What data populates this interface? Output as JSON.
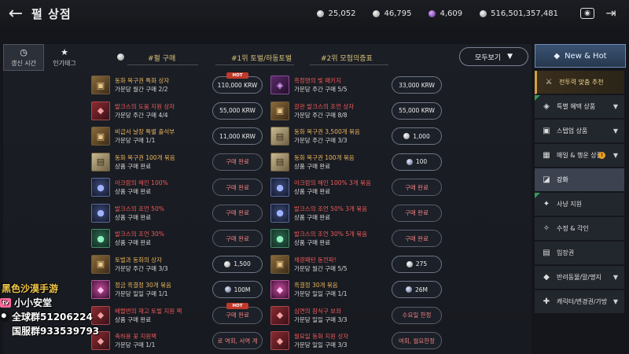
{
  "header": {
    "title": "펄 상점",
    "currencies": [
      {
        "icon": "silver-coin-icon",
        "value": "25,052"
      },
      {
        "icon": "silver-coin-icon",
        "value": "46,795"
      },
      {
        "icon": "purple-gem-icon",
        "value": "4,609"
      },
      {
        "icon": "silver-coin-icon",
        "value": "516,501,357,481"
      }
    ]
  },
  "tabs": {
    "refresh_time": "갱신 시간",
    "popular": "인기태그"
  },
  "sort_headers": [
    "#펄 구매",
    "#1위 토벌/하동토벌",
    "#2위 모험의증표"
  ],
  "filter_dropdown": "모두보기",
  "hot_label": "HOT",
  "rows": [
    [
      {
        "thumb": "chest",
        "name": "동화 복구권 특화 상자",
        "name_color": "orange",
        "limit": "가문당 월간 구매 2/2",
        "price": "110,000 KRW",
        "coin": "",
        "hot": true,
        "done": false
      },
      {
        "thumb": "purple",
        "name": "흑정령의 빛 패키지",
        "name_color": "red",
        "limit": "가문당 주간 구매 5/5",
        "price": "33,000 KRW",
        "coin": "",
        "hot": false,
        "done": false
      }
    ],
    [
      {
        "thumb": "red",
        "name": "발크스의 도움 지원 상자",
        "name_color": "red",
        "limit": "가문당 주간 구매 4/4",
        "price": "55,000 KRW",
        "coin": "",
        "hot": false,
        "done": false
      },
      {
        "thumb": "chest",
        "name": "갈관 발크스의 조언 상자",
        "name_color": "red",
        "limit": "가문당 주간 구매 8/8",
        "price": "55,000 KRW",
        "coin": "",
        "hot": false,
        "done": false
      }
    ],
    [
      {
        "thumb": "chest",
        "name": "비급서 날장 특별 출석부",
        "name_color": "orange",
        "limit": "가문당 구매 1/1",
        "price": "11,000 KRW",
        "coin": "",
        "hot": false,
        "done": false
      },
      {
        "thumb": "scroll",
        "name": "동화 복구권 3,500개 묶음",
        "name_color": "orange",
        "limit": "가문당 주간 구매 3/3",
        "price": "1,000",
        "coin": "white",
        "hot": false,
        "done": false
      }
    ],
    [
      {
        "thumb": "scroll",
        "name": "동화 복구권 100개 묶음",
        "name_color": "orange",
        "limit": "상품 구매 완료",
        "price": "구매 완료",
        "coin": "",
        "hot": false,
        "done": true
      },
      {
        "thumb": "scroll",
        "name": "동화 복구권 100개 묶음",
        "name_color": "orange",
        "limit": "상품 구매 완료",
        "price": "100",
        "coin": "blue",
        "hot": false,
        "done": false
      }
    ],
    [
      {
        "thumb": "gem",
        "name": "아크람의 해인 100%",
        "name_color": "red",
        "limit": "상품 구매 완료",
        "price": "구매 완료",
        "coin": "",
        "hot": false,
        "done": true
      },
      {
        "thumb": "gem",
        "name": "아크람의 해인 100% 3개 묶음",
        "name_color": "red",
        "limit": "상품 구매 완료",
        "price": "구매 완료",
        "coin": "",
        "hot": false,
        "done": true
      }
    ],
    [
      {
        "thumb": "gem",
        "name": "발크스의 조언 50%",
        "name_color": "red",
        "limit": "상품 구매 완료",
        "price": "구매 완료",
        "coin": "",
        "hot": false,
        "done": true
      },
      {
        "thumb": "gem",
        "name": "발크스의 조언 50% 3개 묶음",
        "name_color": "red",
        "limit": "상품 구매 완료",
        "price": "구매 완료",
        "coin": "",
        "hot": false,
        "done": true
      }
    ],
    [
      {
        "thumb": "green",
        "name": "발크스의 조언 30%",
        "name_color": "red",
        "limit": "상품 구매 완료",
        "price": "구매 완료",
        "coin": "",
        "hot": false,
        "done": true
      },
      {
        "thumb": "green",
        "name": "발크스의 조언 30% 5개 묶음",
        "name_color": "red",
        "limit": "상품 구매 완료",
        "price": "구매 완료",
        "coin": "",
        "hot": false,
        "done": true
      }
    ],
    [
      {
        "thumb": "chest",
        "name": "토벌과 동화의 상자",
        "name_color": "orange",
        "limit": "가문당 주간 구매 3/3",
        "price": "1,500",
        "coin": "white",
        "hot": false,
        "done": false
      },
      {
        "thumb": "chest",
        "name": "채광패턴 동전파!",
        "name_color": "red",
        "limit": "가문당 월간 구매 5/5",
        "price": "275",
        "coin": "white",
        "hot": false,
        "done": false
      }
    ],
    [
      {
        "thumb": "pink",
        "name": "정금 흑결정 30개 묶음",
        "name_color": "orange",
        "limit": "가문당 일일 구매 1/1",
        "price": "100M",
        "coin": "blue",
        "hot": false,
        "done": false
      },
      {
        "thumb": "pink",
        "name": "흑결정 30개 묶음",
        "name_color": "orange",
        "limit": "가문당 일일 구매 1/1",
        "price": "26M",
        "coin": "blue",
        "hot": false,
        "done": false
      }
    ],
    [
      {
        "thumb": "red",
        "name": "배럴번의 재고 토벌 지원 팩",
        "name_color": "red",
        "limit": "상품 구매 완료",
        "price": "구매 완료",
        "coin": "",
        "hot": true,
        "done": true
      },
      {
        "thumb": "red",
        "name": "심연의 잠식구 보좌",
        "name_color": "red",
        "limit": "가문당 일일 구매 3/3",
        "price": "수요일 한정",
        "coin": "",
        "hot": false,
        "done": true
      }
    ],
    [
      {
        "thumb": "red",
        "name": "축하용 꽃 지원팩",
        "name_color": "red",
        "limit": "가문당 구매 1/1",
        "price": "로 역회, 서역 계",
        "coin": "",
        "hot": false,
        "done": true
      },
      {
        "thumb": "red",
        "name": "월요일 동화 지원 상자",
        "name_color": "red",
        "limit": "가문당 일일 구매 3/3",
        "price": "여회, 월요한정",
        "coin": "",
        "hot": false,
        "done": true
      }
    ]
  ],
  "sidebar": {
    "header": "New & Hot",
    "categories": [
      {
        "label": "전투력 맞춤 추천",
        "icon": "sword-icon",
        "glyph": "⚔",
        "chev": false,
        "badge": false,
        "style": "highlight"
      },
      {
        "label": "특별 혜택 상품",
        "icon": "gift-icon",
        "glyph": "◈",
        "chev": true,
        "badge": false,
        "style": ""
      },
      {
        "label": "스탭업 상품",
        "icon": "box-icon",
        "glyph": "▣",
        "chev": true,
        "badge": false,
        "style": ""
      },
      {
        "label": "매일 & 행운 상점",
        "icon": "calendar-icon",
        "glyph": "▦",
        "chev": true,
        "badge": true,
        "style": ""
      },
      {
        "label": "강화",
        "icon": "enhance-icon",
        "glyph": "◪",
        "chev": false,
        "badge": false,
        "style": "active"
      },
      {
        "label": "사냥 지원",
        "icon": "hunt-icon",
        "glyph": "✦",
        "chev": false,
        "badge": false,
        "style": ""
      },
      {
        "label": "수정 & 각인",
        "icon": "crystal-icon",
        "glyph": "✧",
        "chev": false,
        "badge": false,
        "style": ""
      },
      {
        "label": "입장권",
        "icon": "ticket-icon",
        "glyph": "▤",
        "chev": false,
        "badge": false,
        "style": ""
      },
      {
        "label": "반려동물/말/명지",
        "icon": "pet-icon",
        "glyph": "◆",
        "chev": true,
        "badge": false,
        "style": ""
      },
      {
        "label": "캐릭터/변경권/가방",
        "icon": "bag-icon",
        "glyph": "✚",
        "chev": true,
        "badge": false,
        "style": ""
      }
    ]
  },
  "overlay": {
    "line1": "黑色沙漠手游",
    "line2": "小小安堂",
    "line3": "全球群51206224",
    "line4": "国服群933539793"
  }
}
